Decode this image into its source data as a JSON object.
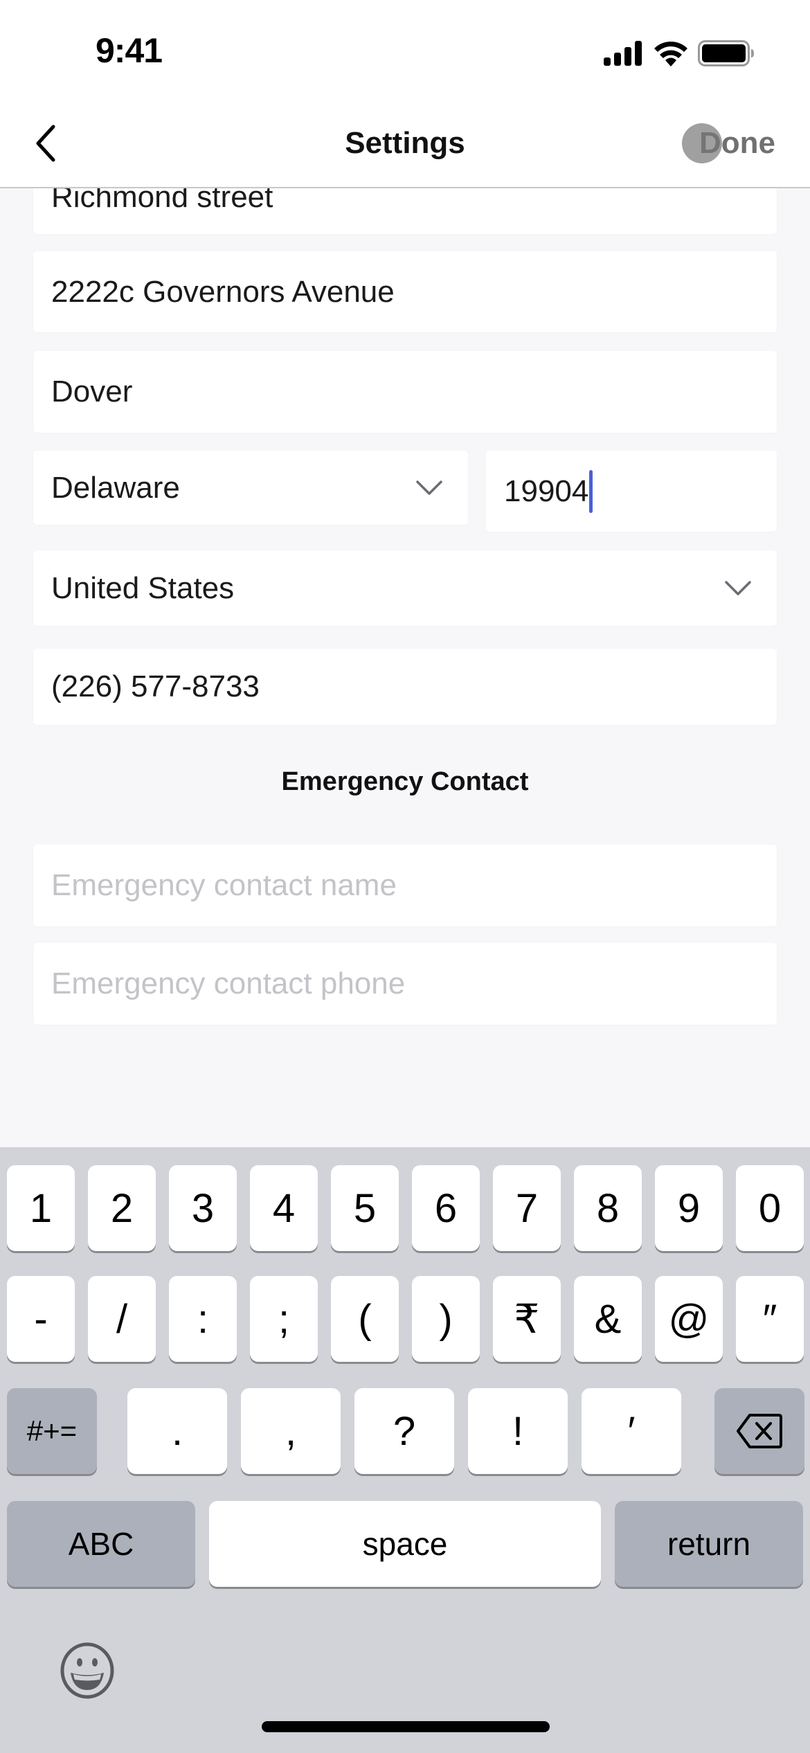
{
  "status_bar": {
    "time": "9:41",
    "icons": [
      "cellular-signal-icon",
      "wifi-icon",
      "battery-icon"
    ]
  },
  "nav": {
    "title": "Settings",
    "back_icon": "chevron-left-icon",
    "done_label": "Done"
  },
  "form": {
    "address_line1": {
      "value": "Richmond street"
    },
    "address_line2": {
      "value": "2222c Governors Avenue"
    },
    "city": {
      "value": "Dover"
    },
    "state": {
      "value": "Delaware",
      "icon": "chevron-down-icon"
    },
    "zip": {
      "value": "19904",
      "focused": true
    },
    "country": {
      "value": "United States",
      "icon": "chevron-down-icon"
    },
    "phone": {
      "value": "(226) 577-8733"
    },
    "emergency_section_title": "Emergency Contact",
    "emergency_name": {
      "value": "",
      "placeholder": "Emergency contact name"
    },
    "emergency_phone": {
      "value": "",
      "placeholder": "Emergency contact phone"
    }
  },
  "keyboard": {
    "row1": [
      "1",
      "2",
      "3",
      "4",
      "5",
      "6",
      "7",
      "8",
      "9",
      "0"
    ],
    "row2": [
      "-",
      "/",
      ":",
      ";",
      "(",
      ")",
      "₹",
      "&",
      "@",
      "″"
    ],
    "row3": {
      "mode_key": "#+=",
      "keys": [
        ".",
        ",",
        "?",
        "!",
        "′"
      ],
      "delete_icon": "backspace-icon"
    },
    "row4": {
      "abc": "ABC",
      "space": "space",
      "return": "return"
    },
    "emoji_icon": "emoji-smile-icon"
  },
  "colors": {
    "caret": "#4a5fd6",
    "keyboard_bg": "#d1d3d9",
    "page_bg": "#f7f6f9",
    "placeholder": "#c4c3c8"
  }
}
